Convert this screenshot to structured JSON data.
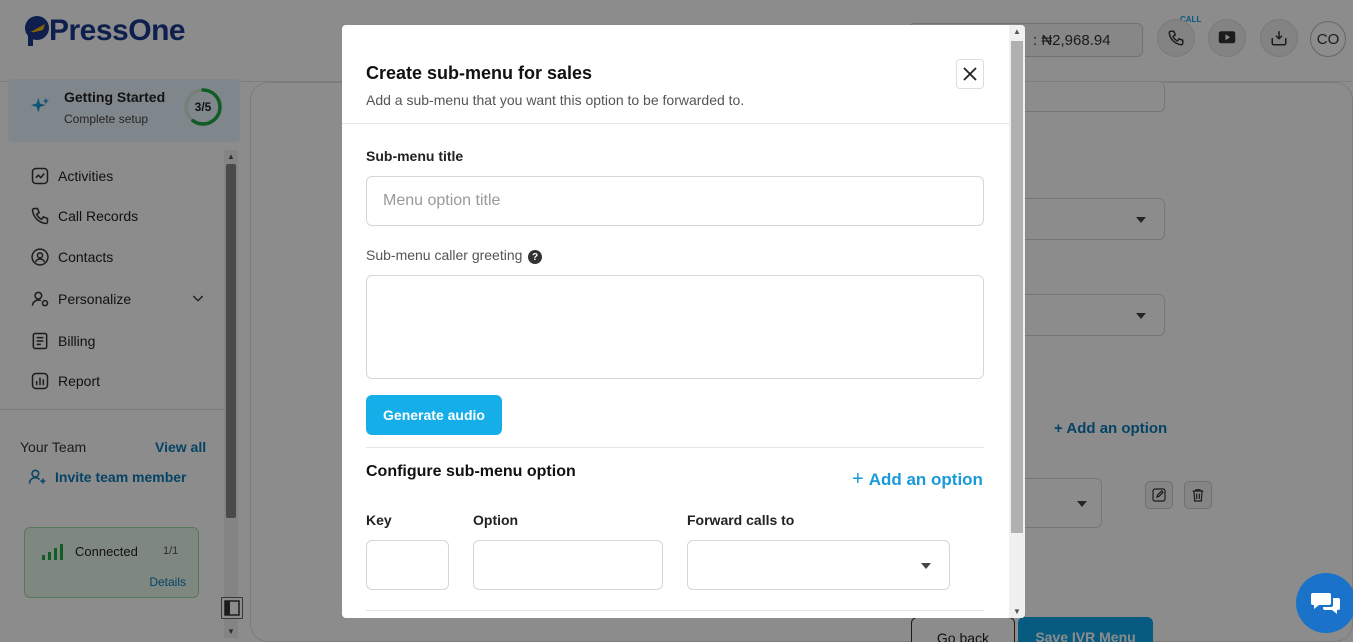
{
  "app": {
    "logo_text": "PressOne",
    "balance_text": ": ₦2,968.94",
    "call_tag": "CALL",
    "avatar_initials": "CO"
  },
  "sidebar": {
    "getting_started": {
      "title": "Getting Started",
      "subtitle": "Complete setup",
      "progress": "3/5",
      "progress_fraction": 0.6
    },
    "items": [
      {
        "label": "Activities",
        "icon": "activities-icon"
      },
      {
        "label": "Call Records",
        "icon": "phone-icon"
      },
      {
        "label": "Contacts",
        "icon": "contact-icon"
      },
      {
        "label": "Personalize",
        "icon": "personalize-icon"
      },
      {
        "label": "Billing",
        "icon": "billing-icon"
      },
      {
        "label": "Report",
        "icon": "report-icon"
      }
    ],
    "team": {
      "label": "Your Team",
      "view_all": "View all",
      "invite": "Invite team member"
    },
    "connection": {
      "label": "Connected",
      "count": "1/1",
      "details": "Details"
    }
  },
  "background": {
    "add_option": "+ Add an option",
    "go_back": "Go back",
    "save": "Save IVR Menu"
  },
  "modal": {
    "title": "Create sub-menu for sales",
    "subtitle": "Add a sub-menu that you want this option to be forwarded to.",
    "submenu_title_label": "Sub-menu title",
    "submenu_title_placeholder": "Menu option title",
    "submenu_title_value": "",
    "greeting_label": "Sub-menu caller greeting",
    "greeting_help": "?",
    "greeting_value": "",
    "generate_audio": "Generate audio",
    "configure_title": "Configure sub-menu option",
    "add_option": "Add an option",
    "columns": {
      "key": "Key",
      "option": "Option",
      "forward": "Forward calls to"
    }
  },
  "colors": {
    "brand_blue": "#1b3a8f",
    "accent": "#16aee8",
    "link": "#1a9ad6",
    "progress_green": "#22a845"
  }
}
